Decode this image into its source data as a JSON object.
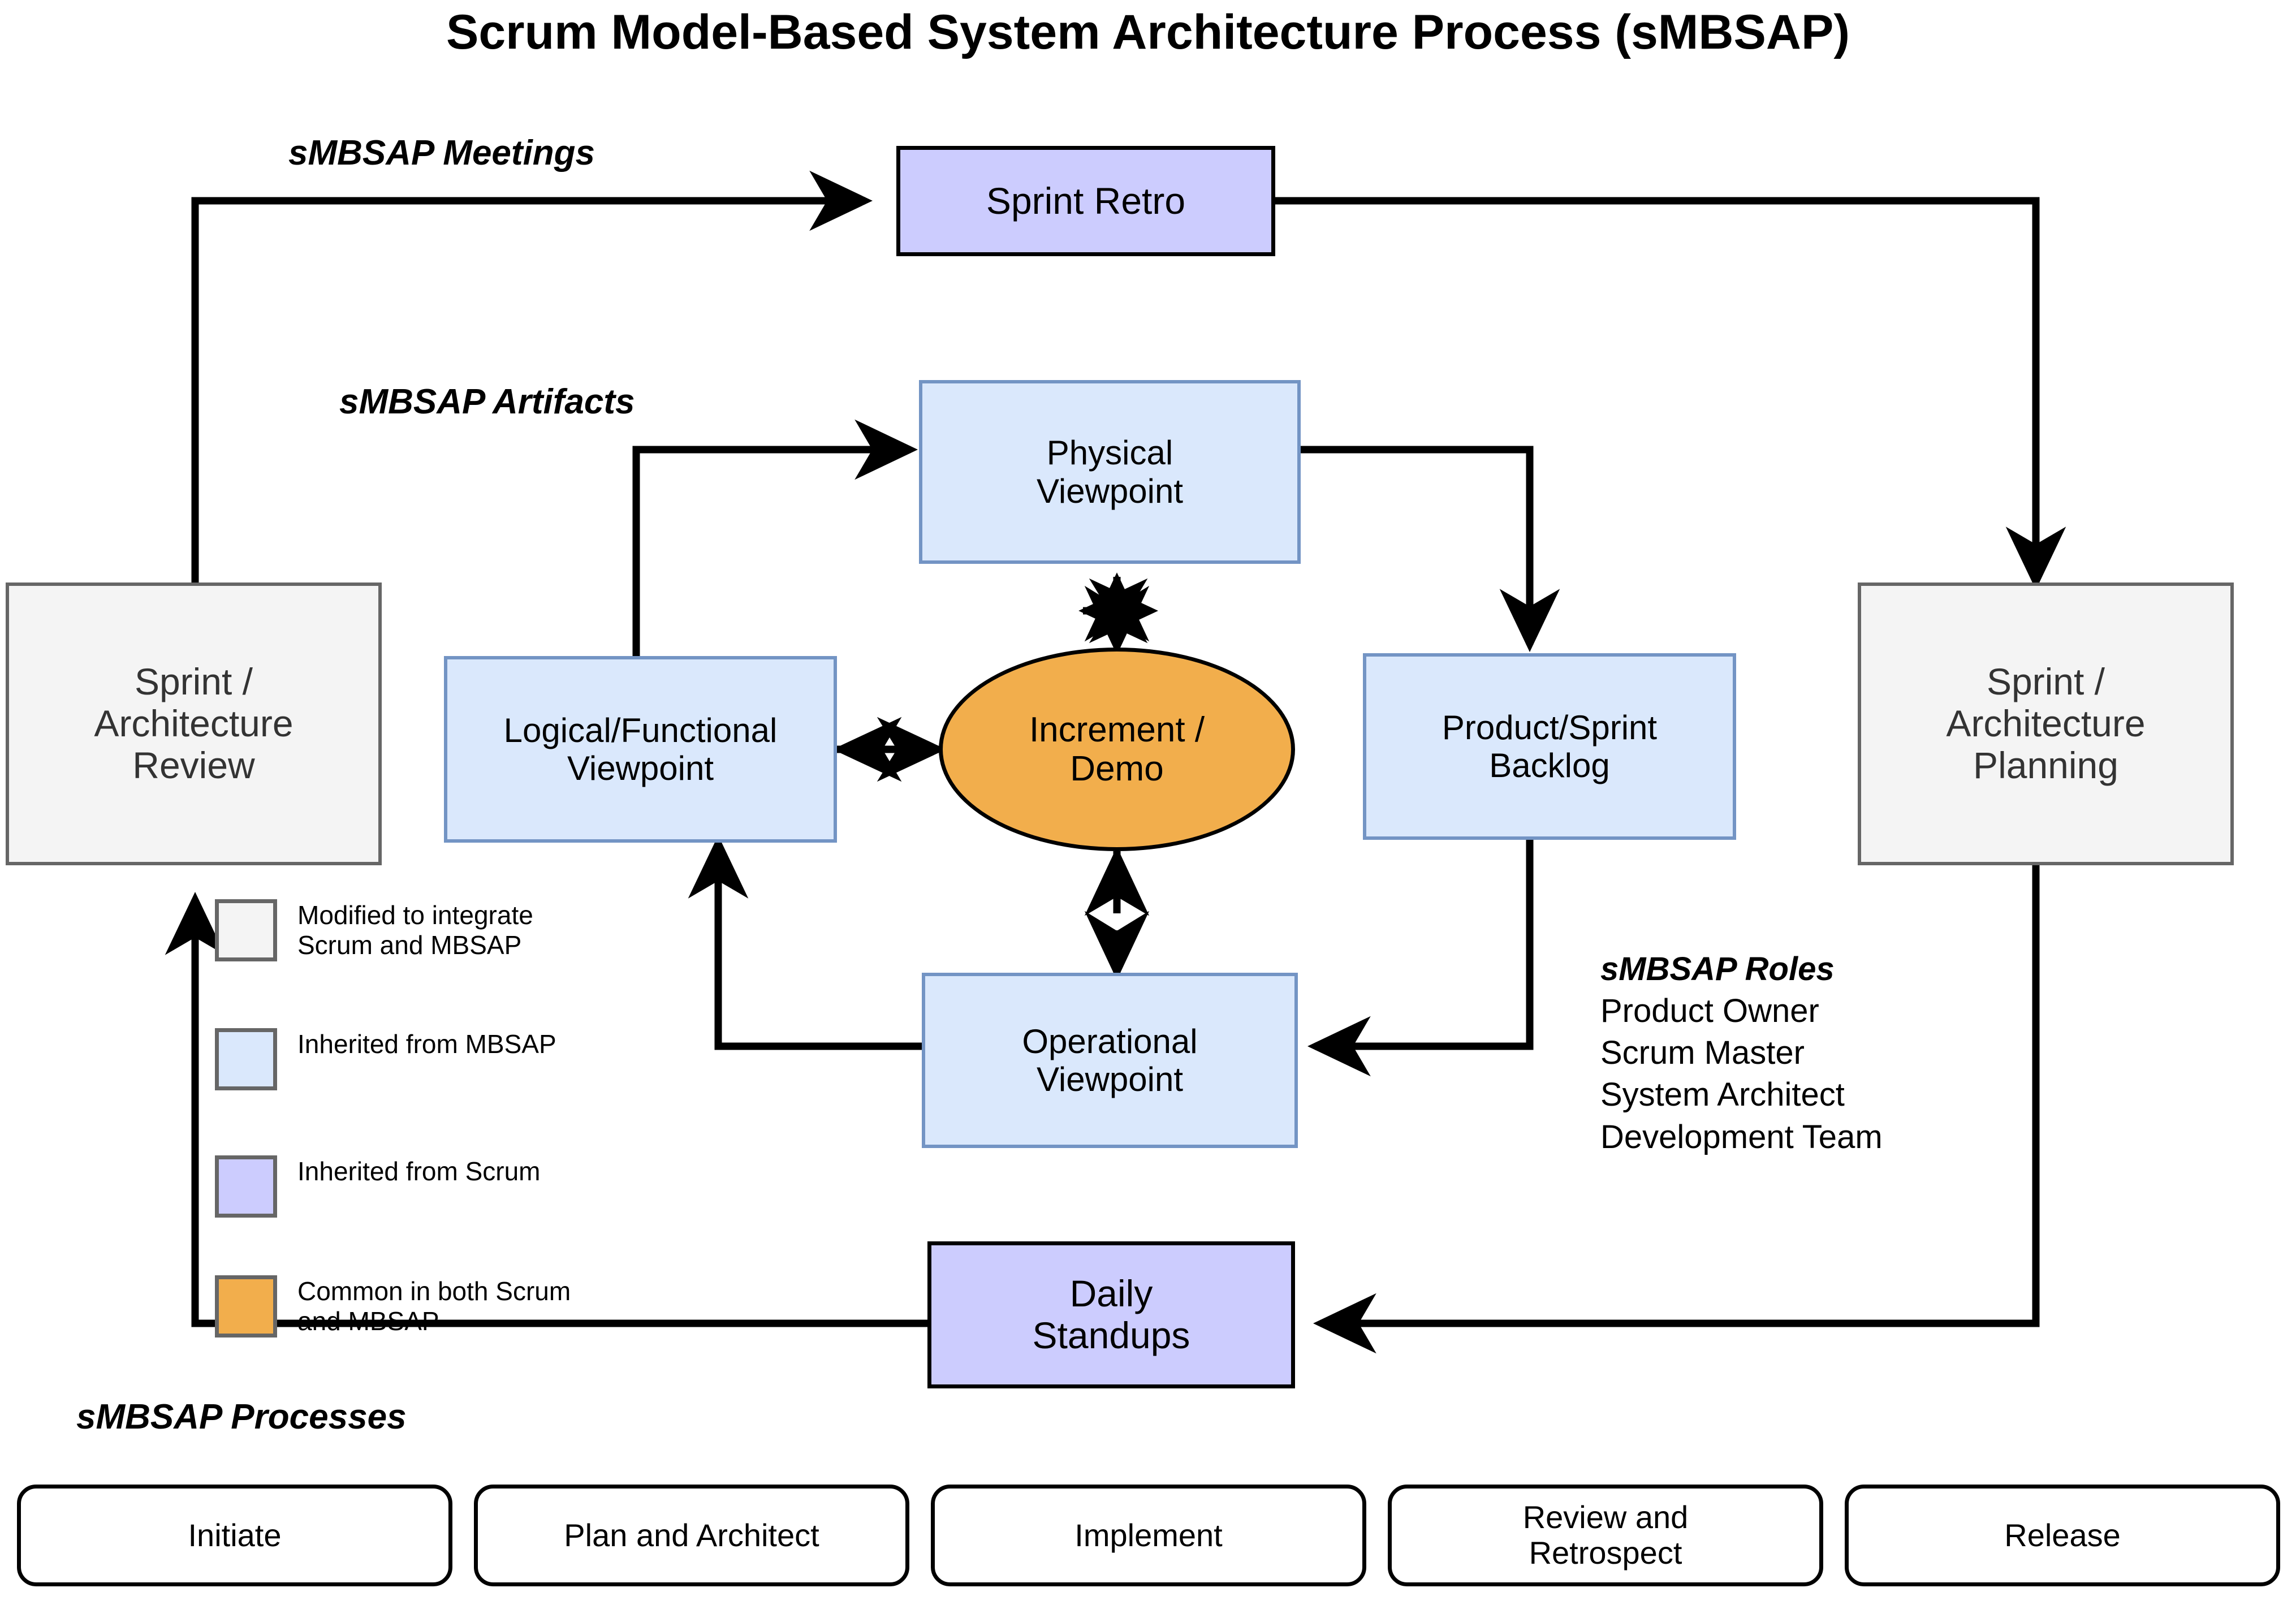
{
  "title": "Scrum Model-Based System Architecture Process (sMBSAP)",
  "sections": {
    "meetings_label": "sMBSAP Meetings",
    "artifacts_label": "sMBSAP Artifacts",
    "roles_label": "sMBSAP Roles",
    "processes_label": "sMBSAP Processes"
  },
  "nodes": {
    "sprint_retro": "Sprint Retro",
    "physical_viewpoint": "Physical\nViewpoint",
    "logical_viewpoint": "Logical/Functional\nViewpoint",
    "increment_demo": "Increment /\nDemo",
    "product_sprint_backlog": "Product/Sprint\nBacklog",
    "operational_viewpoint": "Operational\nViewpoint",
    "sprint_architecture_review": "Sprint /\nArchitecture\nReview",
    "sprint_architecture_planning": "Sprint /\nArchitecture\nPlanning",
    "daily_standups": "Daily\nStandups"
  },
  "legend": [
    {
      "color": "#f4f4f4",
      "label": "Modified to integrate\nScrum and MBSAP"
    },
    {
      "color": "#dae8fc",
      "label": "Inherited from MBSAP"
    },
    {
      "color": "#ccccfe",
      "label": "Inherited from Scrum"
    },
    {
      "color": "#f2ae4c",
      "label": "Common in both Scrum\nand MBSAP"
    }
  ],
  "roles": [
    "Product Owner",
    "Scrum Master",
    "System Architect",
    "Development Team"
  ],
  "processes": [
    "Initiate",
    "Plan and Architect",
    "Implement",
    "Review and\nRetrospect",
    "Release"
  ],
  "colors": {
    "gray_fill": "#f4f4f4",
    "gray_border": "#666666",
    "blue_fill": "#dae8fc",
    "blue_border": "#7394c4",
    "purple_fill": "#ccccfe",
    "orange_fill": "#f2ae4c",
    "line": "#000000"
  }
}
